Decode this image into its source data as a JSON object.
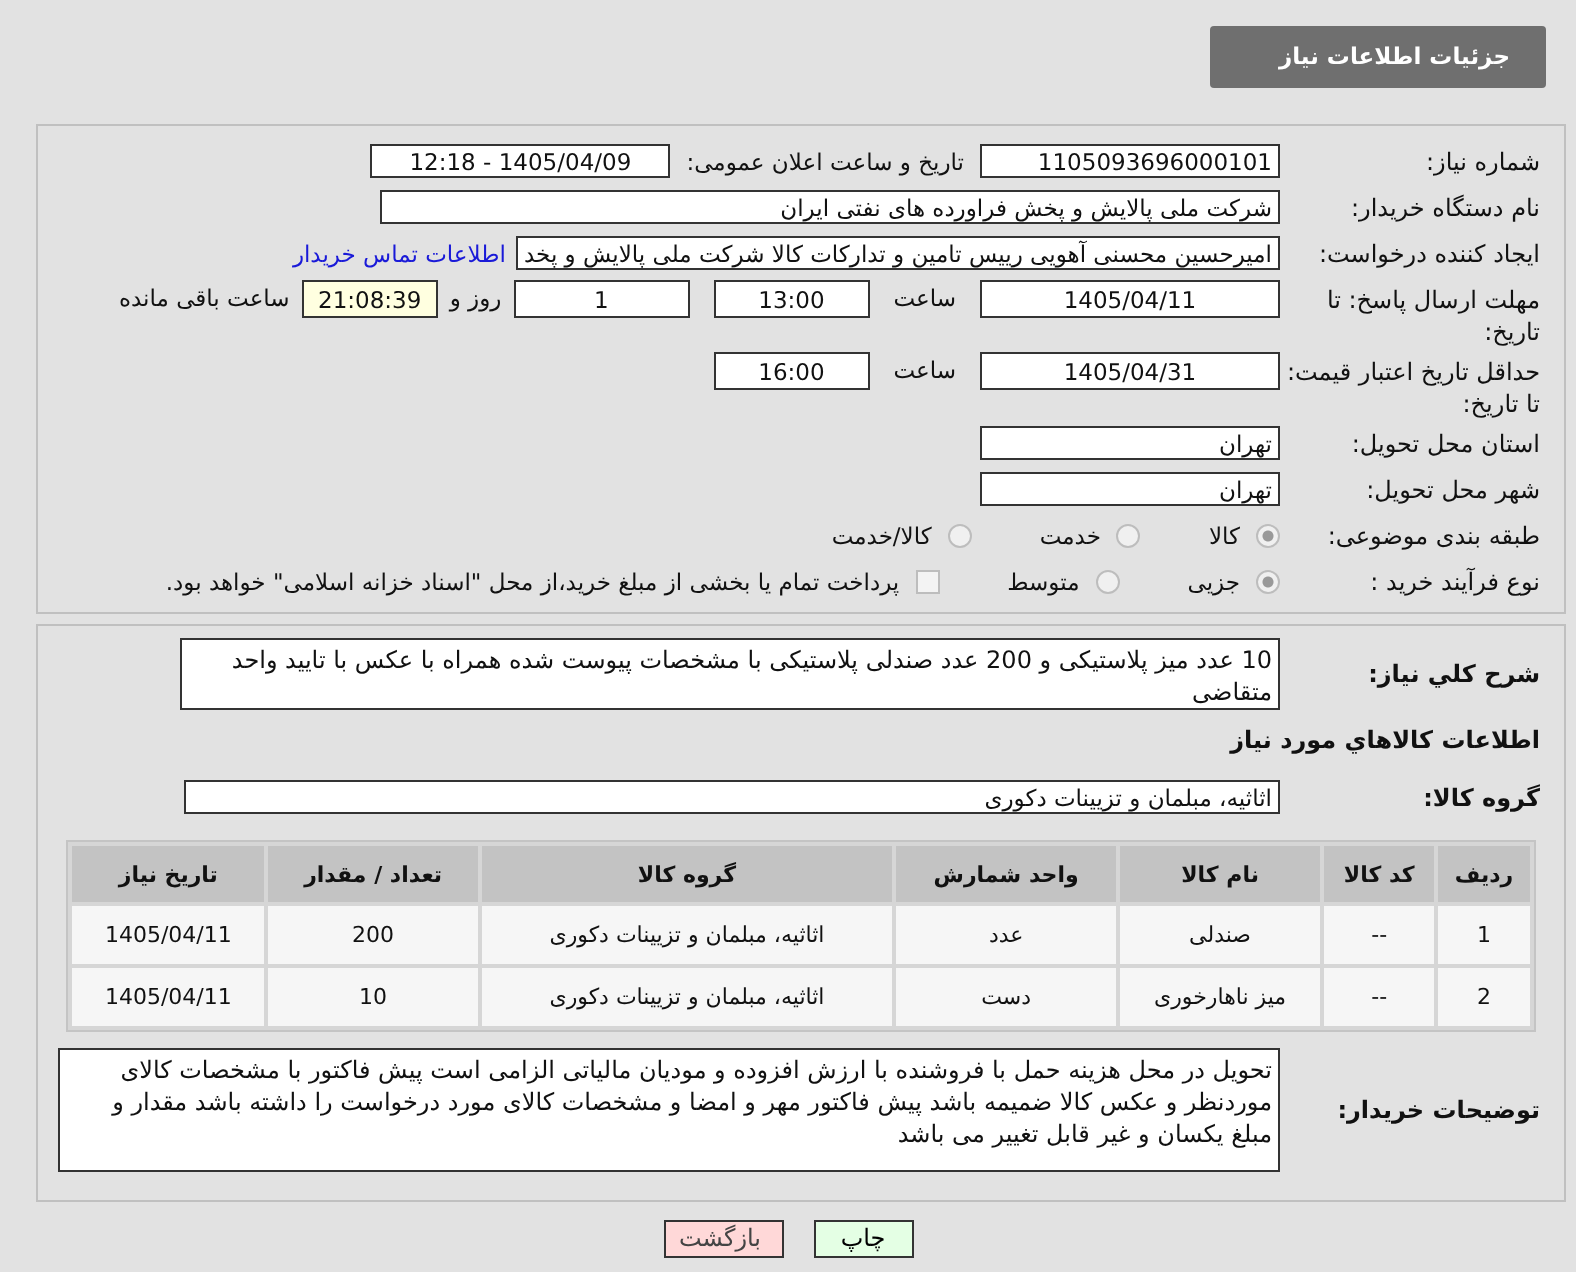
{
  "header": {
    "title": "جزئیات اطلاعات نیاز"
  },
  "need_number": {
    "label": "شماره نیاز:",
    "value": "1105093696000101"
  },
  "announce": {
    "label": "تاریخ و ساعت اعلان عمومی:",
    "value": "1405/04/09 - 12:18"
  },
  "buyer_org": {
    "label": "نام دستگاه خریدار:",
    "value": "شرکت ملی پالایش و پخش فراورده های نفتی ایران"
  },
  "requester": {
    "label": "ایجاد کننده درخواست:",
    "value": "امیرحسین محسنی آهویی رییس تامین و تدارکات کالا شرکت ملی پالایش و پخد",
    "link": "اطلاعات تماس خریدار"
  },
  "deadline": {
    "label": "مهلت ارسال پاسخ: تا تاریخ:",
    "date": "1405/04/11",
    "time_label": "ساعت",
    "time": "13:00",
    "days": "1",
    "days_label": "روز و",
    "remaining": "21:08:39",
    "remaining_label": "ساعت باقی مانده"
  },
  "validity": {
    "label": "حداقل تاریخ اعتبار قیمت: تا تاریخ:",
    "date": "1405/04/31",
    "time_label": "ساعت",
    "time": "16:00"
  },
  "province": {
    "label": "استان محل تحویل:",
    "value": "تهران"
  },
  "city": {
    "label": "شهر محل تحویل:",
    "value": "تهران"
  },
  "category": {
    "label": "طبقه بندی موضوعی:",
    "options": [
      {
        "label": "کالا",
        "selected": true
      },
      {
        "label": "خدمت",
        "selected": false
      },
      {
        "label": "کالا/خدمت",
        "selected": false
      }
    ]
  },
  "process": {
    "label": "نوع فرآیند خرید :",
    "options": [
      {
        "label": "جزیی",
        "selected": true
      },
      {
        "label": "متوسط",
        "selected": false
      }
    ],
    "payment": {
      "checked": false,
      "text": "پرداخت تمام یا بخشی از مبلغ خرید،از محل \"اسناد خزانه اسلامی\" خواهد بود."
    }
  },
  "description": {
    "label": "شرح کلي نیاز:",
    "value": "10 عدد میز پلاستیکی و 200 عدد صندلی پلاستیکی با مشخصات پیوست شده همراه با عکس با تایید واحد متقاضی"
  },
  "goods": {
    "title": "اطلاعات کالاهاي مورد نیاز",
    "group_label": "گروه کالا:",
    "group": "اثاثیه، مبلمان و تزیینات دکوری"
  },
  "table": {
    "columns": [
      "ردیف",
      "کد کالا",
      "نام کالا",
      "واحد شمارش",
      "گروه کالا",
      "تعداد / مقدار",
      "تاریخ نیاز"
    ],
    "rows": [
      [
        "1",
        "--",
        "صندلی",
        "عدد",
        "اثاثیه، مبلمان و تزیینات دکوری",
        "200",
        "1405/04/11"
      ],
      [
        "2",
        "--",
        "میز ناهارخوری",
        "دست",
        "اثاثیه، مبلمان و تزیینات دکوری",
        "10",
        "1405/04/11"
      ]
    ]
  },
  "notes": {
    "label": "توضیحات خریدار:",
    "value": "تحویل در محل هزینه حمل با فروشنده با ارزش افزوده و مودیان مالیاتی الزامی است پیش فاکتور با مشخصات کالای موردنظر و عکس کالا ضمیمه باشد پیش فاکتور مهر و امضا و مشخصات کالای مورد درخواست را داشته باشد مقدار و مبلغ یکسان و غیر قابل تغییر می باشد"
  },
  "buttons": [
    {
      "kind": "print",
      "label": "چاپ"
    },
    {
      "kind": "back",
      "label": "بازگشت"
    }
  ]
}
